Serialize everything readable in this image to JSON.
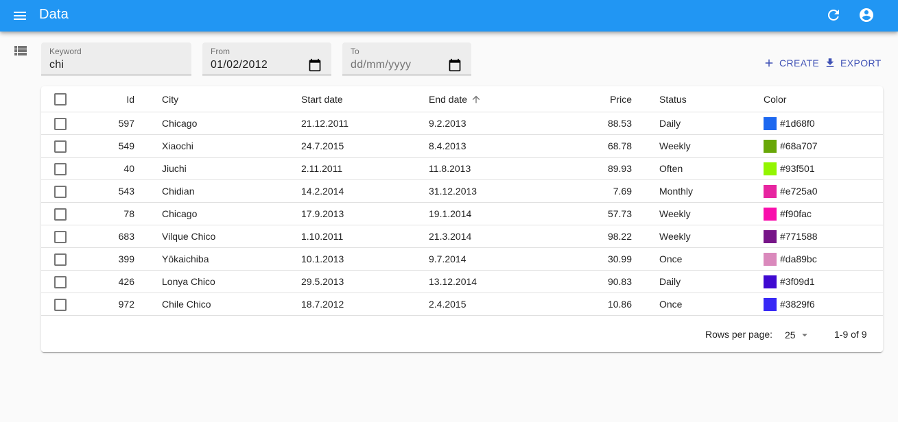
{
  "appbar": {
    "title": "Data",
    "menu_icon": "menu-icon",
    "refresh_icon": "refresh-icon",
    "account_icon": "account-circle-icon"
  },
  "filters": {
    "keyword": {
      "label": "Keyword",
      "value": "chi"
    },
    "from": {
      "label": "From",
      "value": "01/02/2012"
    },
    "to": {
      "label": "To",
      "placeholder": "dd/mm/yyyy",
      "value": ""
    }
  },
  "actions": {
    "create_label": "CREATE",
    "export_label": "EXPORT"
  },
  "table": {
    "columns": {
      "id": "Id",
      "city": "City",
      "start": "Start date",
      "end": "End date",
      "price": "Price",
      "status": "Status",
      "color": "Color"
    },
    "sorted_by": "End date",
    "sort_direction": "ascending",
    "rows": [
      {
        "id": "597",
        "city": "Chicago",
        "start": "21.12.2011",
        "end": "9.2.2013",
        "price": "88.53",
        "status": "Daily",
        "color": "#1d68f0"
      },
      {
        "id": "549",
        "city": "Xiaochi",
        "start": "24.7.2015",
        "end": "8.4.2013",
        "price": "68.78",
        "status": "Weekly",
        "color": "#68a707"
      },
      {
        "id": "40",
        "city": "Jiuchi",
        "start": "2.11.2011",
        "end": "11.8.2013",
        "price": "89.93",
        "status": "Often",
        "color": "#93f501"
      },
      {
        "id": "543",
        "city": "Chidian",
        "start": "14.2.2014",
        "end": "31.12.2013",
        "price": "7.69",
        "status": "Monthly",
        "color": "#e725a0"
      },
      {
        "id": "78",
        "city": "Chicago",
        "start": "17.9.2013",
        "end": "19.1.2014",
        "price": "57.73",
        "status": "Weekly",
        "color": "#f90fac"
      },
      {
        "id": "683",
        "city": "Vilque Chico",
        "start": "1.10.2011",
        "end": "21.3.2014",
        "price": "98.22",
        "status": "Weekly",
        "color": "#771588"
      },
      {
        "id": "399",
        "city": "Yōkaichiba",
        "start": "10.1.2013",
        "end": "9.7.2014",
        "price": "30.99",
        "status": "Once",
        "color": "#da89bc"
      },
      {
        "id": "426",
        "city": "Lonya Chico",
        "start": "29.5.2013",
        "end": "13.12.2014",
        "price": "90.83",
        "status": "Daily",
        "color": "#3f09d1"
      },
      {
        "id": "972",
        "city": "Chile Chico",
        "start": "18.7.2012",
        "end": "2.4.2015",
        "price": "10.86",
        "status": "Once",
        "color": "#3829f6"
      }
    ]
  },
  "pagination": {
    "rows_per_page_label": "Rows per page:",
    "rows_per_page": "25",
    "range": "1-9 of 9"
  },
  "colors": {
    "appbar": "#2196f3",
    "action": "#3f51b5",
    "background": "#fafafa"
  }
}
